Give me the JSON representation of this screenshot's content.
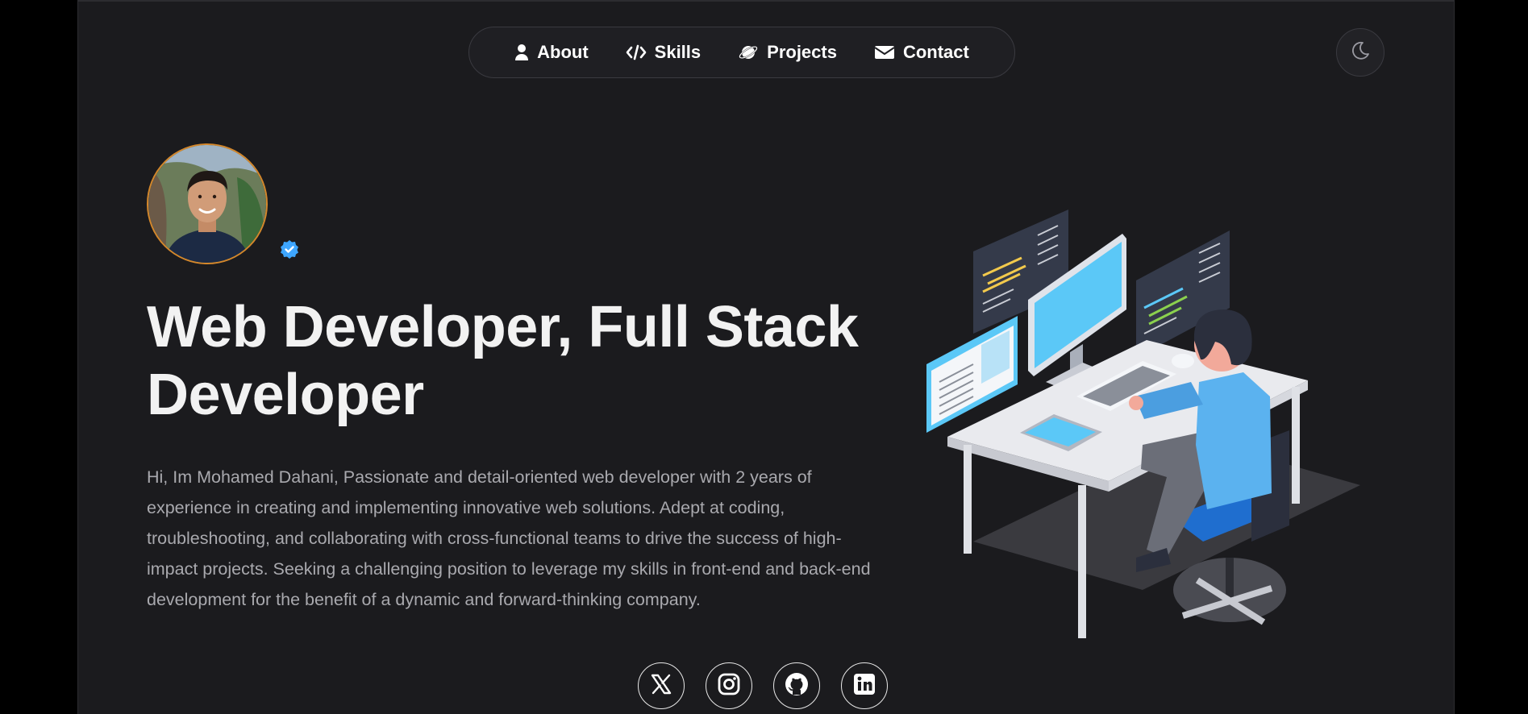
{
  "nav": {
    "items": [
      {
        "label": "About",
        "icon": "user-icon"
      },
      {
        "label": "Skills",
        "icon": "code-icon"
      },
      {
        "label": "Projects",
        "icon": "planet-icon"
      },
      {
        "label": "Contact",
        "icon": "envelope-icon"
      }
    ]
  },
  "theme_toggle": {
    "icon": "moon-icon"
  },
  "profile": {
    "verified_icon": "verified-badge-icon",
    "verified_color": "#3ea6ff",
    "avatar_border_color": "#d4872b"
  },
  "hero": {
    "title_line1": "Web Developer, Full Stack",
    "title_line2": "Developer",
    "bio": "Hi, Im Mohamed Dahani, Passionate and detail-oriented web developer with 2 years of experience in creating and implementing innovative web solutions. Adept at coding, troubleshooting, and collaborating with cross-functional teams to drive the success of high-impact projects. Seeking a challenging position to leverage my skills in front-end and back-end development for the benefit of a dynamic and forward-thinking company."
  },
  "socials": [
    {
      "icon": "x-twitter-icon"
    },
    {
      "icon": "instagram-icon"
    },
    {
      "icon": "github-icon"
    },
    {
      "icon": "linkedin-icon"
    }
  ],
  "colors": {
    "background": "#1b1b1e",
    "text": "#f2f2f2",
    "muted_text": "#a9a9ae",
    "accent_blue": "#5bc8f7"
  }
}
